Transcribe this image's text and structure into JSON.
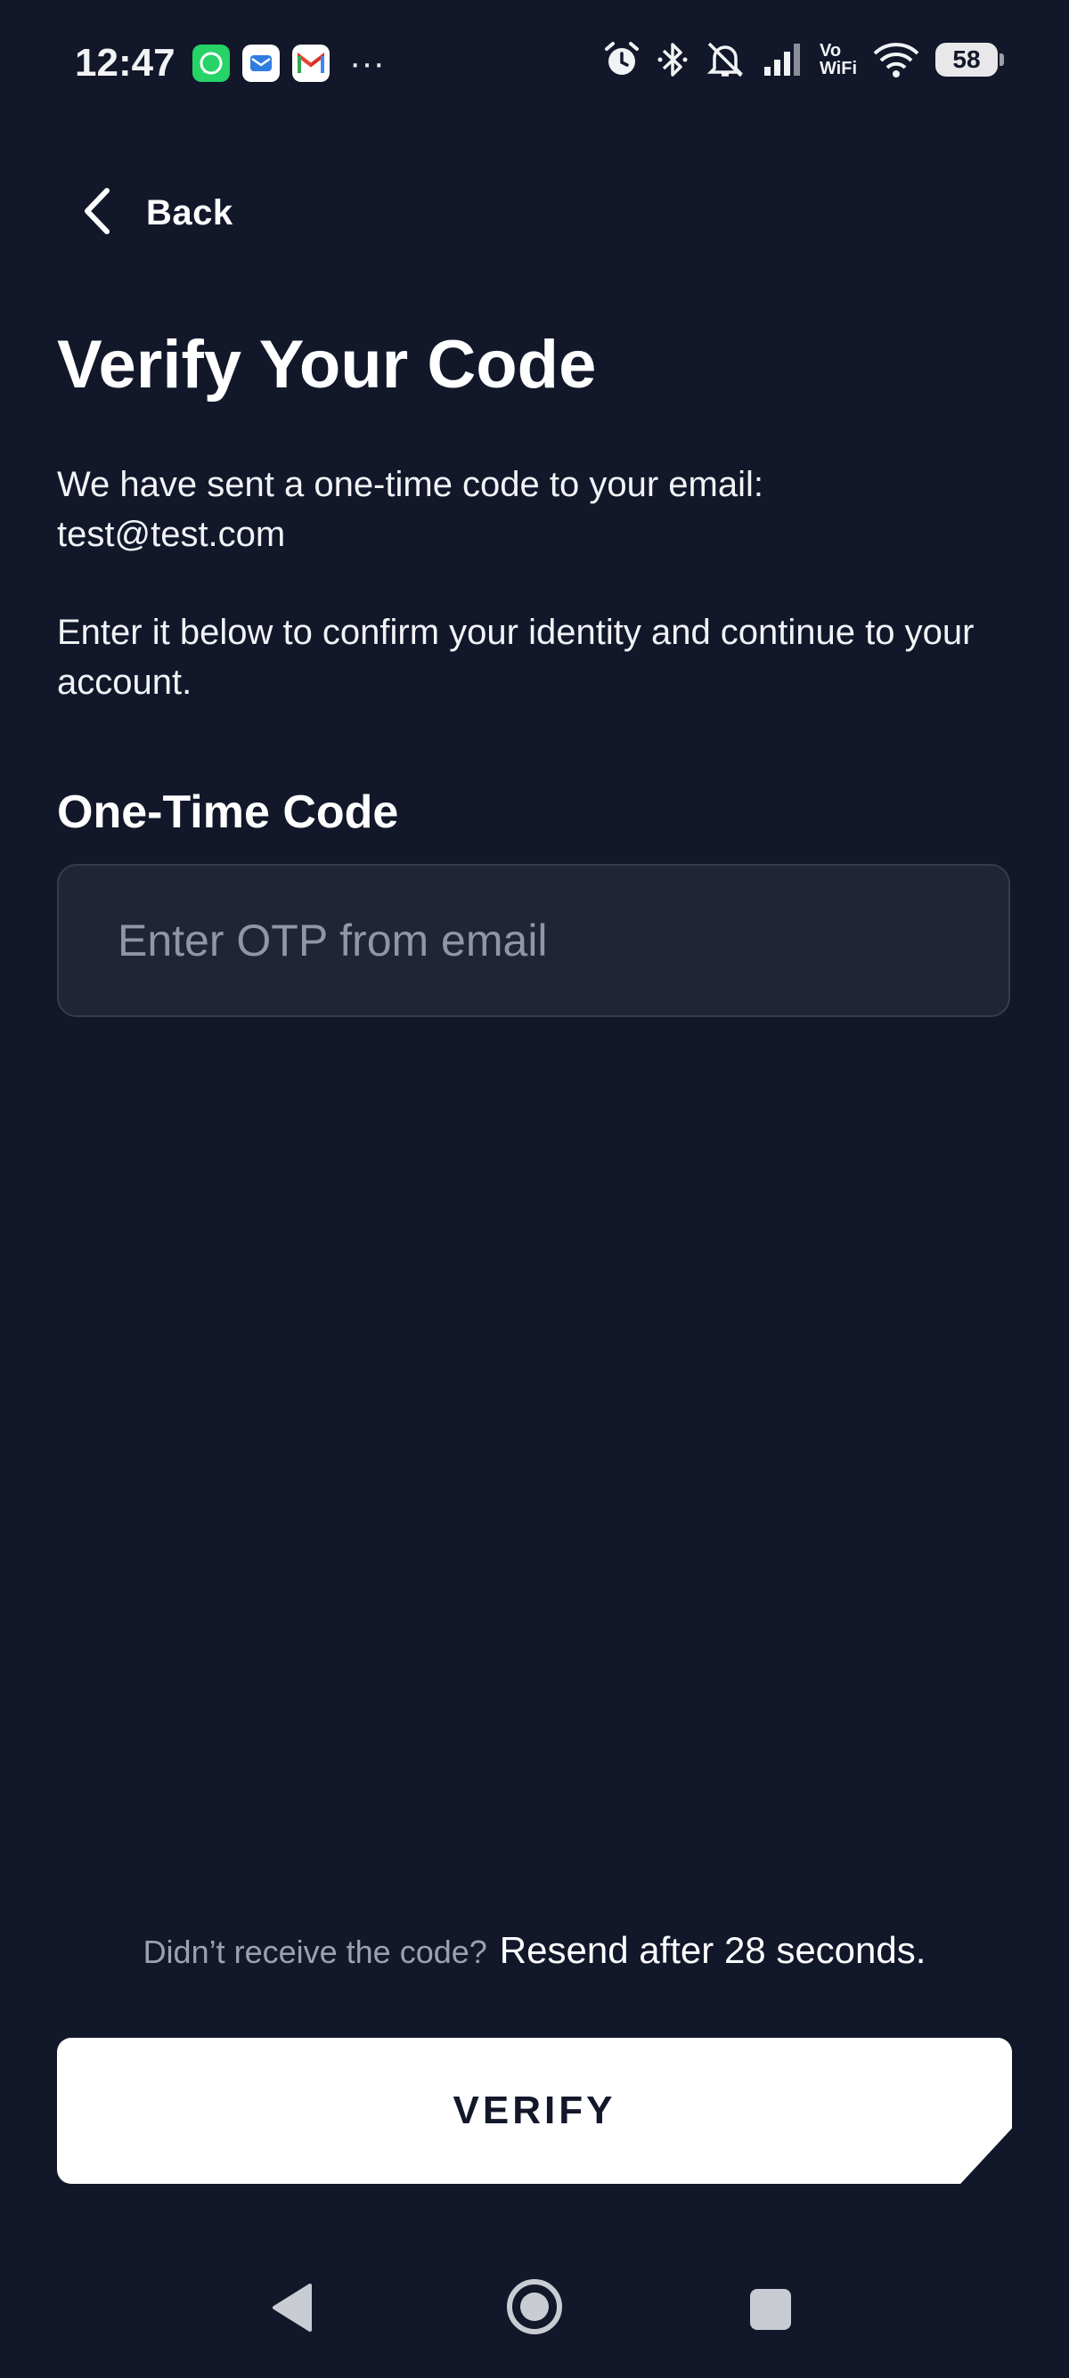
{
  "status_bar": {
    "time": "12:47",
    "notification_icons": [
      "whatsapp-icon",
      "mail-app-icon",
      "gmail-icon"
    ],
    "more": "···",
    "system_icons": [
      "alarm-icon",
      "bluetooth-icon",
      "silent-icon",
      "signal-icon",
      "vowifi-icon",
      "wifi-icon"
    ],
    "vowifi_top": "Vo",
    "vowifi_bottom": "WiFi",
    "battery": "58"
  },
  "header": {
    "back_label": "Back"
  },
  "main": {
    "title": "Verify Your Code",
    "sent_text": "We have sent a one-time code to your email:",
    "email": "test@test.com",
    "instruction": "Enter it below to confirm your identity and continue to your account.",
    "field_label": "One-Time Code",
    "otp_placeholder": "Enter OTP from email",
    "otp_value": ""
  },
  "footer": {
    "resend_question": "Didn’t receive the code?",
    "resend_timer": "Resend after 28 seconds.",
    "verify_label": "VERIFY"
  },
  "colors": {
    "background": "#12172a",
    "input_bg": "#1f2537",
    "whatsapp": "#25d366",
    "mail_app": "#2f7de1"
  }
}
